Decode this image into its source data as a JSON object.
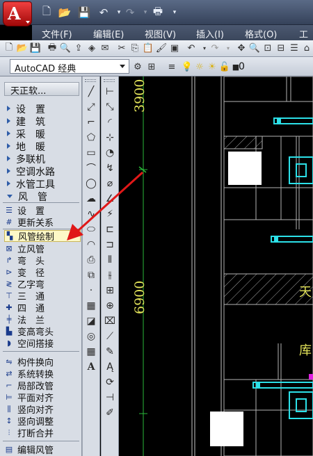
{
  "app": {
    "logo_letter": "A",
    "menu": [
      "文件(F)",
      "编辑(E)",
      "视图(V)",
      "插入(I)",
      "格式(O)",
      "工"
    ]
  },
  "workspace": {
    "selected": "AutoCAD 经典",
    "layer_value": "0"
  },
  "palette": {
    "title": "天正软...",
    "categories": [
      {
        "label": "设　置",
        "open": false
      },
      {
        "label": "建　筑",
        "open": false
      },
      {
        "label": "采　暖",
        "open": false
      },
      {
        "label": "地　暖",
        "open": false
      },
      {
        "label": "多联机",
        "open": false
      },
      {
        "label": "空调水路",
        "open": false
      },
      {
        "label": "水管工具",
        "open": false
      },
      {
        "label": "风　管",
        "open": true
      }
    ],
    "commands_group1": [
      {
        "label": "设　置",
        "icon": "duct-settings-icon"
      },
      {
        "label": "更新关系",
        "icon": "update-relation-icon"
      }
    ],
    "commands_group2": [
      {
        "label": "风管绘制",
        "icon": "duct-draw-icon",
        "active": true
      },
      {
        "label": "立风管",
        "icon": "vertical-duct-icon"
      },
      {
        "label": "弯　头",
        "icon": "elbow-icon"
      },
      {
        "label": "变　径",
        "icon": "reducer-icon"
      },
      {
        "label": "乙字弯",
        "icon": "offset-bend-icon"
      },
      {
        "label": "三　通",
        "icon": "tee-icon"
      },
      {
        "label": "四　通",
        "icon": "cross-icon"
      },
      {
        "label": "法　兰",
        "icon": "flange-icon"
      },
      {
        "label": "变高弯头",
        "icon": "height-elbow-icon"
      },
      {
        "label": "空间搭接",
        "icon": "space-joint-icon"
      }
    ],
    "commands_group3": [
      {
        "label": "构件换向",
        "icon": "component-reverse-icon"
      },
      {
        "label": "系统转换",
        "icon": "system-convert-icon"
      },
      {
        "label": "局部改管",
        "icon": "local-modify-icon"
      },
      {
        "label": "平面对齐",
        "icon": "plane-align-icon"
      },
      {
        "label": "竖向对齐",
        "icon": "vertical-align-icon"
      },
      {
        "label": "竖向调整",
        "icon": "vertical-adjust-icon"
      },
      {
        "label": "打断合并",
        "icon": "break-merge-icon"
      }
    ],
    "commands_group4": [
      {
        "label": "编辑风管",
        "icon": "edit-duct-icon"
      }
    ]
  },
  "drawing": {
    "dims": [
      "3900",
      "6900"
    ],
    "labels": [
      "天",
      "库"
    ]
  },
  "colors": {
    "cad_yellow": "#e4e45a",
    "cad_cyan": "#2ce0e8",
    "cad_green": "#2ab83a",
    "callout_red": "#e01818",
    "active_highlight": "#fdf8c7"
  }
}
